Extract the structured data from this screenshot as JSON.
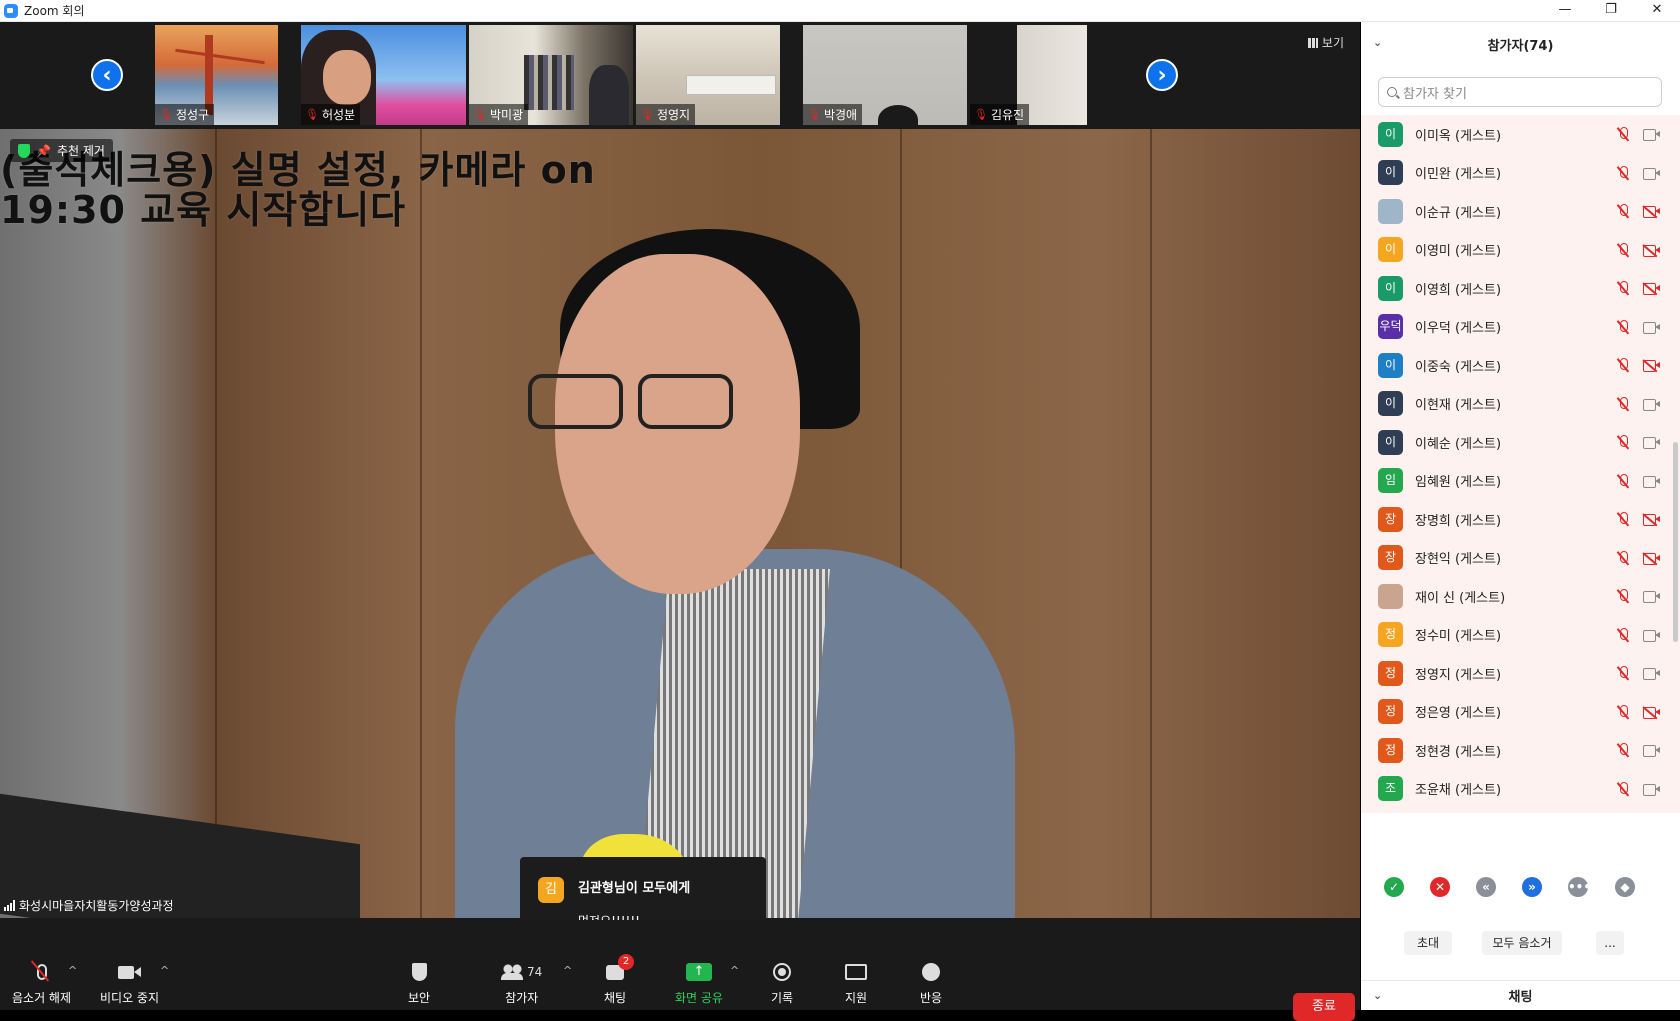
{
  "window": {
    "title": "Zoom 회의",
    "minimize": "—",
    "restore": "❐",
    "close": "✕"
  },
  "thumbnails": [
    {
      "name": "정성구"
    },
    {
      "name": "허성분"
    },
    {
      "name": "박미광"
    },
    {
      "name": "정영지"
    },
    {
      "name": "박경애"
    },
    {
      "name": "김유진"
    }
  ],
  "view_button": "보기",
  "main_video": {
    "badge": "추천 제거",
    "overlay_line1": "(출석체크용) 실명 설정, 카메라 on",
    "overlay_line2": "19:30 교육 시작합니다",
    "speaker_name": "화성시마을자치활동가양성과정"
  },
  "chat_toast": {
    "avatar": "김",
    "from": "김관형님이 모두에게",
    "message": "멋져요!!!!!!"
  },
  "toolbar": {
    "unmute": "음소거 해제",
    "stop_video": "비디오 중지",
    "security": "보안",
    "participants": "참가자",
    "participants_count": "74",
    "chat": "채팅",
    "chat_badge": "2",
    "share": "화면 공유",
    "record": "기록",
    "support": "지원",
    "reactions": "반응",
    "end": "종료"
  },
  "panel": {
    "title": "참가자(74)",
    "search_placeholder": "참가자 찾기",
    "participants": [
      {
        "initial": "이",
        "name": "이미옥 (게스트)",
        "color": "#1a9a6b",
        "cam_off": false
      },
      {
        "initial": "이",
        "name": "이민완 (게스트)",
        "color": "#2f3e55",
        "cam_off": false
      },
      {
        "initial": "",
        "name": "이순규 (게스트)",
        "color": "#9fb6c8",
        "cam_off": true
      },
      {
        "initial": "이",
        "name": "이영미 (게스트)",
        "color": "#f4a620",
        "cam_off": true
      },
      {
        "initial": "이",
        "name": "이영희 (게스트)",
        "color": "#1a9a6b",
        "cam_off": true
      },
      {
        "initial": "우덕",
        "name": "이우덕 (게스트)",
        "color": "#5a2ea6",
        "cam_off": false
      },
      {
        "initial": "이",
        "name": "이중숙 (게스트)",
        "color": "#1f7fc4",
        "cam_off": true
      },
      {
        "initial": "이",
        "name": "이현재 (게스트)",
        "color": "#2f3e55",
        "cam_off": false
      },
      {
        "initial": "이",
        "name": "이혜순 (게스트)",
        "color": "#2f3e55",
        "cam_off": false
      },
      {
        "initial": "임",
        "name": "임혜원 (게스트)",
        "color": "#23a84e",
        "cam_off": false
      },
      {
        "initial": "장",
        "name": "장명희 (게스트)",
        "color": "#e0581a",
        "cam_off": true
      },
      {
        "initial": "장",
        "name": "장현익 (게스트)",
        "color": "#e0581a",
        "cam_off": true
      },
      {
        "initial": "",
        "name": "재이 신 (게스트)",
        "color": "#c9a58f",
        "cam_off": false
      },
      {
        "initial": "정",
        "name": "정수미 (게스트)",
        "color": "#f4a620",
        "cam_off": false
      },
      {
        "initial": "정",
        "name": "정영지 (게스트)",
        "color": "#e0581a",
        "cam_off": false
      },
      {
        "initial": "정",
        "name": "정은영 (게스트)",
        "color": "#e0581a",
        "cam_off": true
      },
      {
        "initial": "정",
        "name": "정현경 (게스트)",
        "color": "#e0581a",
        "cam_off": false
      },
      {
        "initial": "조",
        "name": "조윤채 (게스트)",
        "color": "#23a84e",
        "cam_off": false
      }
    ],
    "reactions": [
      {
        "icon": "✓",
        "color": "#23a84e"
      },
      {
        "icon": "✕",
        "color": "#e02828"
      },
      {
        "icon": "«",
        "color": "#8a8f99"
      },
      {
        "icon": "»",
        "color": "#1f6fe0"
      },
      {
        "icon": "•••",
        "color": "#8a8f99"
      },
      {
        "icon": "◆",
        "color": "#8a8f99"
      }
    ],
    "invite": "초대",
    "mute_all": "모두 음소거",
    "more": "...",
    "chat_title": "채팅"
  },
  "colors": {
    "accent_blue": "#0e72ed",
    "end_red": "#e02828",
    "share_green": "#23b650"
  }
}
